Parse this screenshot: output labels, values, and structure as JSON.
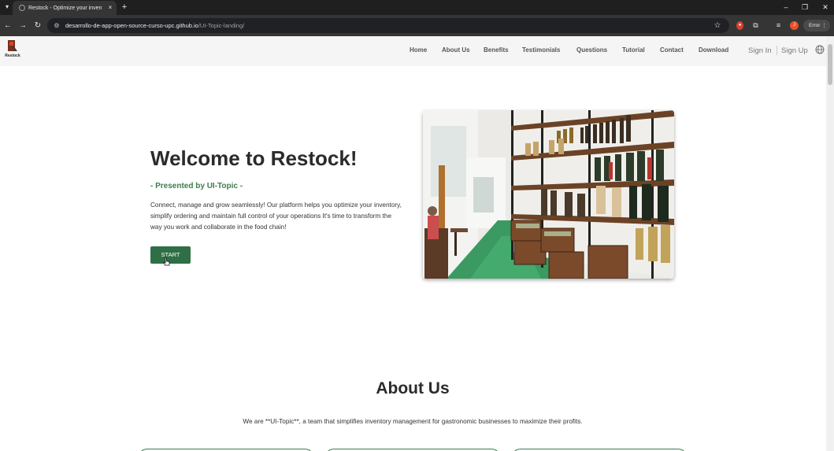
{
  "browser": {
    "tab_title": "Restock - Optimize your inven",
    "tab_close_glyph": "×",
    "new_tab_glyph": "+",
    "url_host": "desarrollo-de-app-open-source-curso-upc.github.io",
    "url_path": "/UI-Topic-landing/",
    "profile_initial": "J",
    "error_chip": "Error",
    "icons": [
      "tab-menu-icon",
      "globe-favicon-icon",
      "back-icon",
      "forward-icon",
      "reload-icon",
      "site-info-icon",
      "star-icon",
      "extension-red-icon",
      "puzzle-icon",
      "media-icon",
      "minimize-icon",
      "restore-icon",
      "close-icon",
      "kebab-menu-icon"
    ]
  },
  "header": {
    "logo_text": "Restock",
    "nav": [
      {
        "label": "Home"
      },
      {
        "label": "About Us"
      },
      {
        "label": "Benefits"
      },
      {
        "label": "Testimonials"
      },
      {
        "label": "Questions"
      },
      {
        "label": "Tutorial"
      },
      {
        "label": "Contact"
      },
      {
        "label": "Download"
      }
    ],
    "sign_in": "Sign In",
    "sign_up": "Sign Up",
    "language_icon": "globe-icon"
  },
  "hero": {
    "title": "Welcome to Restock!",
    "subtitle": "- Presented by UI-Topic -",
    "description": "Connect, manage and grow seamlessly! Our platform helps you optimize your inventory, simplify ordering and maintain full control of your operations It's time to transform the way you work and collaborate in the food chain!",
    "cta": "START"
  },
  "about": {
    "title": "About Us",
    "description": "We are **UI-Topic**, a team that simplifies inventory management for gastronomic businesses to maximize their profits."
  },
  "colors": {
    "brand_green": "#2f6f45",
    "subtitle_green": "#3b7d4e",
    "chrome_dark": "#1f1f1f"
  }
}
